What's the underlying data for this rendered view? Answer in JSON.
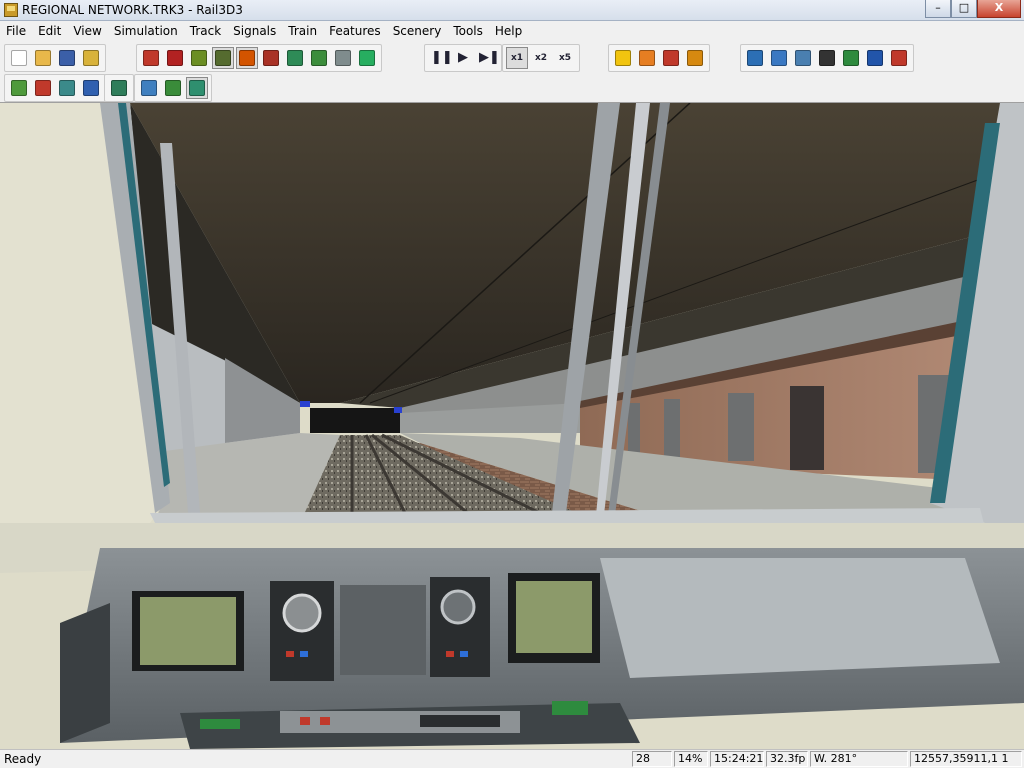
{
  "window": {
    "title": "REGIONAL NETWORK.TRK3 - Rail3D3",
    "controls": {
      "minimize": "–",
      "maximize": "□",
      "close": "X"
    }
  },
  "menu": [
    "File",
    "Edit",
    "View",
    "Simulation",
    "Track",
    "Signals",
    "Train",
    "Features",
    "Scenery",
    "Tools",
    "Help"
  ],
  "toolbar": {
    "row1": {
      "file": [
        {
          "icon": "new-document-icon",
          "color": "#ffffff"
        },
        {
          "icon": "open-folder-icon",
          "color": "#e8b84a"
        },
        {
          "icon": "save-icon",
          "color": "#3b5fa8"
        },
        {
          "icon": "properties-icon",
          "color": "#d8b23a"
        }
      ],
      "edit": [
        {
          "icon": "track-tool-icon",
          "color": "#c0392b"
        },
        {
          "icon": "pen-tool-icon",
          "color": "#b22222"
        },
        {
          "icon": "signal-tool-icon",
          "color": "#6b8e23"
        },
        {
          "icon": "building-tool-icon",
          "color": "#556b2f"
        },
        {
          "icon": "label-tool-icon",
          "color": "#d35400"
        },
        {
          "icon": "train-tool-icon",
          "color": "#a93226"
        },
        {
          "icon": "tree-tool-icon",
          "color": "#2e8b57"
        },
        {
          "icon": "tree-delete-icon",
          "color": "#3c8d3c"
        },
        {
          "icon": "flag-tool-icon",
          "color": "#7f8c8d"
        },
        {
          "icon": "feature-delete-icon",
          "color": "#27ae60"
        }
      ],
      "sim_controls": [
        "❚❚",
        "▶",
        "▶❚"
      ],
      "sim_speed": [
        {
          "icon": "speed-x1-icon",
          "label": "x1"
        },
        {
          "icon": "speed-x2-icon",
          "label": "x2"
        },
        {
          "icon": "speed-x5-icon",
          "label": "x5"
        }
      ],
      "tools": [
        {
          "icon": "timetable-icon",
          "color": "#f1c40f"
        },
        {
          "icon": "edit-timetable-icon",
          "color": "#e67e22"
        },
        {
          "icon": "route-icon",
          "color": "#c0392b"
        },
        {
          "icon": "hammer-icon",
          "color": "#d68910"
        }
      ],
      "view": [
        {
          "icon": "camera-icon",
          "color": "#2c6fb5"
        },
        {
          "icon": "train-view-icon",
          "color": "#3a78c2"
        },
        {
          "icon": "clock-view-icon",
          "color": "#4a7fb0"
        },
        {
          "icon": "inspect-icon",
          "color": "#333333"
        },
        {
          "icon": "map-icon",
          "color": "#2e8b3e"
        },
        {
          "icon": "check-icon",
          "color": "#2255aa"
        },
        {
          "icon": "undo-icon",
          "color": "#c0392b"
        }
      ]
    },
    "row2": {
      "scenery": [
        {
          "icon": "raise-terrain-icon",
          "color": "#4f9a3c"
        },
        {
          "icon": "lower-terrain-icon",
          "color": "#c0392b"
        },
        {
          "icon": "smooth-terrain-icon",
          "color": "#3b8a8a"
        },
        {
          "icon": "paint-terrain-icon",
          "color": "#3060b0"
        }
      ],
      "scenery2": [
        {
          "icon": "flatten-terrain-icon",
          "color": "#2f7d5a"
        }
      ],
      "scenery3": [
        {
          "icon": "hill-icon",
          "color": "#3f7fbf"
        },
        {
          "icon": "mountain-icon",
          "color": "#3a8c3a"
        },
        {
          "icon": "terrain-view-icon",
          "color": "#2f8f6f"
        }
      ]
    }
  },
  "status": {
    "ready": "Ready",
    "panes": [
      "28",
      "14%",
      "15:24:21",
      "32.3fp",
      "W. 281°",
      "12557,35911,1 1"
    ]
  }
}
